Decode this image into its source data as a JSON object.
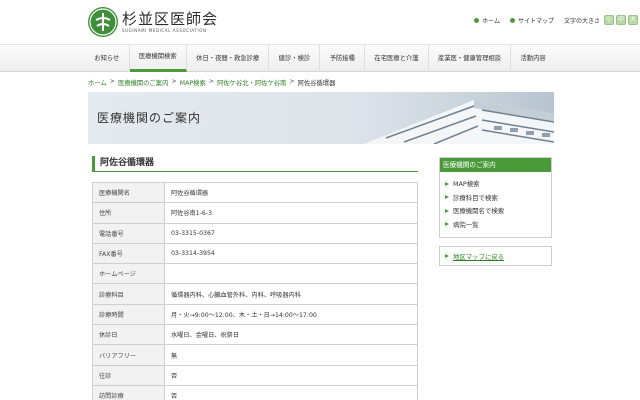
{
  "header": {
    "title": "杉並区医師会",
    "subtitle": "SUGINAMI MEDICAL ASSOCIATION",
    "util_links": [
      {
        "label": "ホーム"
      },
      {
        "label": "サイトマップ"
      }
    ],
    "font_size_label": "文字の大きさ",
    "font_size_buttons": [
      "小",
      "中",
      "大"
    ]
  },
  "nav": {
    "items": [
      {
        "label": "お知らせ"
      },
      {
        "label": "医療機関検索"
      },
      {
        "label": "休日・夜間・救急診療"
      },
      {
        "label": "健診・検診"
      },
      {
        "label": "予防接種"
      },
      {
        "label": "在宅医療と介護"
      },
      {
        "label": "産業医・健康管理相談"
      },
      {
        "label": "活動内容"
      }
    ],
    "active_index": 1
  },
  "breadcrumb": [
    {
      "label": "ホーム",
      "link": true
    },
    {
      "label": "医療機関のご案内",
      "link": true
    },
    {
      "label": "MAP検索",
      "link": true
    },
    {
      "label": "阿佐ケ谷北・阿佐ケ谷南",
      "link": true
    },
    {
      "label": "阿佐谷循環器",
      "link": false
    }
  ],
  "breadcrumb_sep": ">",
  "banner": {
    "title": "医療機関のご案内"
  },
  "main": {
    "title": "阿佐谷循環器",
    "rows": [
      {
        "key": "医療機関名",
        "value": "阿佐谷循環器"
      },
      {
        "key": "住所",
        "value": "阿佐谷南1-6-3"
      },
      {
        "key": "電話番号",
        "value": "03-3315-0367"
      },
      {
        "key": "FAX番号",
        "value": "03-3314-3954"
      },
      {
        "key": "ホームページ",
        "value": ""
      },
      {
        "key": "診療科目",
        "value": "循環器内科、心臓血管外科、内科、呼吸器内科"
      },
      {
        "key": "診療時間",
        "value": "月・火→9:00～12:00、木・土・日→14:00～17:00"
      },
      {
        "key": "休診日",
        "value": "水曜日、金曜日、祝祭日"
      },
      {
        "key": "バリアフリー",
        "value": "無"
      },
      {
        "key": "往診",
        "value": "否"
      },
      {
        "key": "訪問診療",
        "value": "否"
      }
    ]
  },
  "sidebar": {
    "heading": "医療機関のご案内",
    "items": [
      {
        "label": "MAP検索"
      },
      {
        "label": "診療科目で検索"
      },
      {
        "label": "医療機関名で検索"
      },
      {
        "label": "病院一覧"
      }
    ],
    "back_link": "地区マップに戻る"
  },
  "colors": {
    "accent": "#4a9a3a",
    "link": "#2f7f26",
    "table_key_bg": "#f2f2f2"
  }
}
